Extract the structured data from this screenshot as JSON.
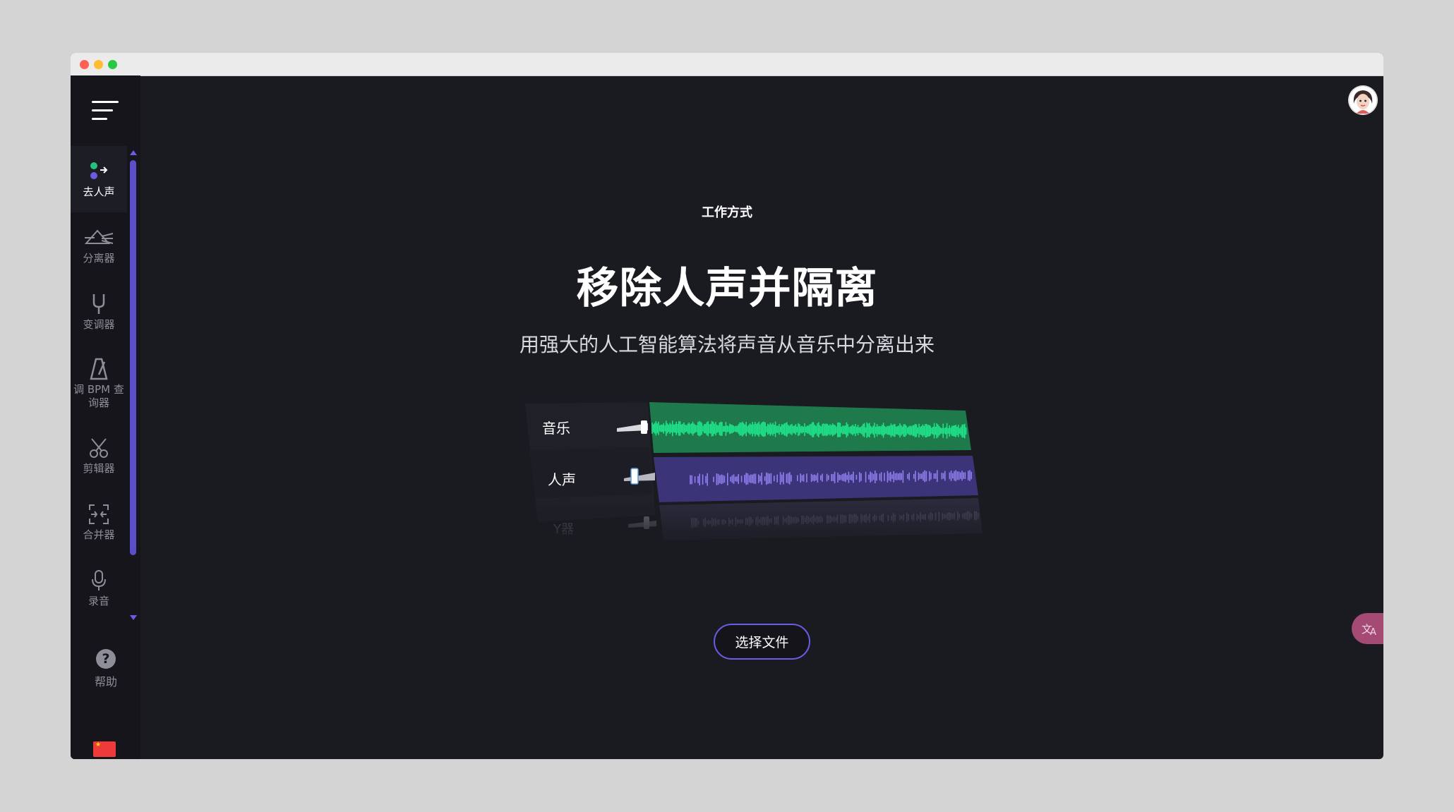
{
  "sidebar": {
    "items": [
      {
        "label": "去人声",
        "icon": "vocal-remover-icon"
      },
      {
        "label": "分离器",
        "icon": "prism-splitter-icon"
      },
      {
        "label": "变调器",
        "icon": "tuning-fork-icon"
      },
      {
        "label": "调 BPM 查询器",
        "icon": "metronome-icon"
      },
      {
        "label": "剪辑器",
        "icon": "scissors-icon"
      },
      {
        "label": "合并器",
        "icon": "merge-icon"
      },
      {
        "label": "录音",
        "icon": "microphone-icon"
      }
    ],
    "help_label": "帮助",
    "language_flag": "cn-flag-icon"
  },
  "main": {
    "section_label": "工作方式",
    "title": "移除人声并隔离",
    "subtitle": "用强大的人工智能算法将声音从音乐中分离出来",
    "tracks": [
      {
        "label": "音乐",
        "color": "#1fe28a"
      },
      {
        "label": "人声",
        "color": "#6f5fe0"
      },
      {
        "label": "Y器",
        "color": "#5b5b7a"
      }
    ],
    "choose_file_label": "选择文件",
    "translate_icon": "translate-icon"
  },
  "colors": {
    "accent": "#6b5ce7",
    "background": "#1a1a21",
    "sidebar": "#15151b"
  }
}
